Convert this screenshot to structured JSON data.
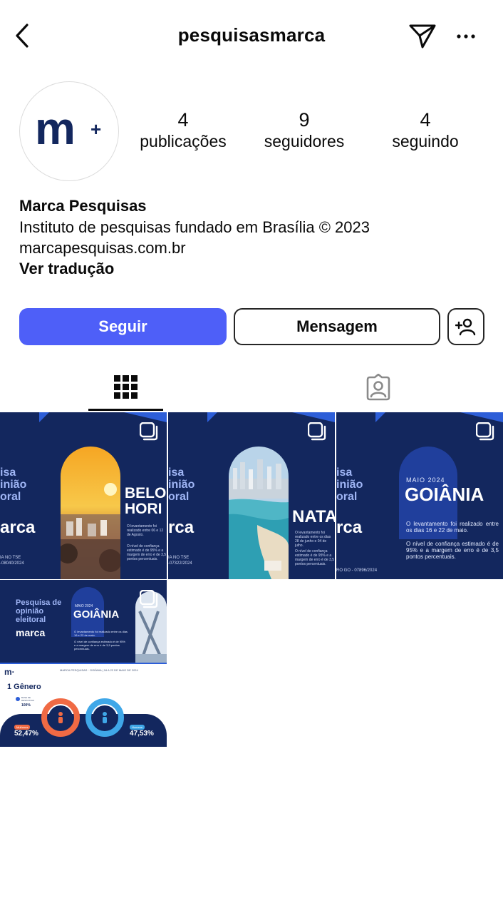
{
  "header": {
    "username": "pesquisasmarca"
  },
  "profile": {
    "avatar_text": "m+",
    "stats": [
      {
        "value": "4",
        "label": "publicações"
      },
      {
        "value": "9",
        "label": "seguidores"
      },
      {
        "value": "4",
        "label": "seguindo"
      }
    ],
    "name": "Marca Pesquisas",
    "bio_line": "Instituto de pesquisas fundado em Brasília © 2023",
    "link": "marcapesquisas.com.br",
    "translate": "Ver tradução"
  },
  "actions": {
    "follow": "Seguir",
    "message": "Mensagem"
  },
  "posts": [
    {
      "side": "isa\ninião\noral",
      "brand": "arca",
      "city": "BELO\nHORI",
      "note1": "O levantamento foi realizado entre 06 e 12 de Agosto.",
      "note2": "O nível de confiança estimado é de 95% e a margem de erro é de 3,5 pontos percentuais.",
      "reg": "IA NO TSE\n-08040/2024"
    },
    {
      "side": "isa\ninião\noral",
      "brand": "rca",
      "city": "NATA",
      "note1": "O levantamento foi realizado entre os dias 28 de junho e 04 de julho.",
      "note2": "O nível de confiança estimado é de 95% e a margem de erro é de 3,5 pontos percentuais.",
      "reg": "IA NO TSE\n-07322/2024"
    },
    {
      "side": "isa\ninião\noral",
      "brand": "rca",
      "date": "MAIO 2024",
      "city": "GOIÂNIA",
      "note1": "O levantamento foi realizado entre os dias 16 e 22 de maio.",
      "note2": "O nível de confiança estimado é de 95% e a margem de erro é de 3,5 pontos percentuais.",
      "reg": "RO GO - 07896/2024"
    },
    {
      "title": "Pesquisa de opinião eleitoral",
      "brand": "marca",
      "date": "MAIO 2024",
      "city": "GOIÂNIA",
      "note1": "O levantamento foi realizado entre os dias 16 e 22 de maio.",
      "note2": "O nível de confiança estimado é de 95% e a margem de erro é de 3,5 pontos percentuais.",
      "footer_logo": "m·",
      "footer_header": "MARCA PESQUISAS · GOIÂNIA | 16 A 22 DE MAIO DE 2024",
      "section": "1 Gênero",
      "legend": "BASE DE RESPOSTAS",
      "base_pct": "100%",
      "female_label": "Mulheres",
      "female_pct": "52,47%",
      "male_label": "Homens",
      "male_pct": "47,53%"
    }
  ],
  "colors": {
    "accent": "#4e5ff8",
    "post_bg": "#13275e",
    "post_accent": "#2d5ed8"
  }
}
